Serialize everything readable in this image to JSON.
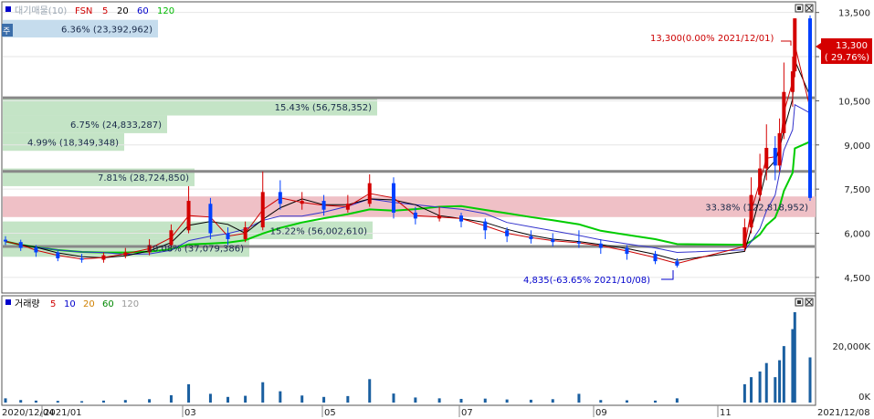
{
  "price_panel": {
    "legend": [
      {
        "text": "대기매물(10)",
        "color": "#9aa6b2"
      },
      {
        "text": "FSN",
        "color": "#d00000"
      },
      {
        "text": "5",
        "color": "#d00000"
      },
      {
        "text": "20",
        "color": "#000000"
      },
      {
        "text": "60",
        "color": "#0000cc"
      },
      {
        "text": "120",
        "color": "#00bb00"
      }
    ],
    "side_tab": "주",
    "y_ticks": [
      "13,500",
      "12,000",
      "10,500",
      "9,000",
      "7,500",
      "6,000",
      "4,500"
    ],
    "current_price": "13,300",
    "current_change": "( 29.76%)",
    "max_annotation": "13,300(0.00% 2021/12/01)",
    "min_annotation": "4,835(-63.65% 2021/10/08)"
  },
  "volume_panel": {
    "legend": [
      {
        "text": "거래량",
        "color": "#000000"
      },
      {
        "text": "5",
        "color": "#d00000"
      },
      {
        "text": "10",
        "color": "#0000cc"
      },
      {
        "text": "20",
        "color": "#d08000"
      },
      {
        "text": "60",
        "color": "#008800"
      },
      {
        "text": "120",
        "color": "#999999"
      }
    ],
    "y_ticks": [
      "20,000K",
      "0K"
    ]
  },
  "x_axis": [
    "2020/12/04",
    "2021/01",
    "03",
    "05",
    "07",
    "09",
    "11",
    "2021/12/08"
  ],
  "chart_data": {
    "type": "candlestick",
    "y_axis": {
      "min": 4000,
      "max": 13800,
      "ticks": [
        13500,
        12000,
        10500,
        9000,
        7500,
        6000,
        4500
      ]
    },
    "volume_axis": {
      "min": 0,
      "max": 32000,
      "unit": "K",
      "ticks": [
        20000,
        0
      ]
    },
    "resistance_lines": [
      10600,
      8100,
      5550
    ],
    "volume_profile": [
      {
        "label": "6.36% (23,392,962)",
        "y_low": 12650,
        "y_high": 13250,
        "highlight": false
      },
      {
        "label": "15.43% (56,758,352)",
        "y_low": 10000,
        "y_high": 10600,
        "highlight": false
      },
      {
        "label": "6.75% (24,833,287)",
        "y_low": 9400,
        "y_high": 10000,
        "highlight": false
      },
      {
        "label": "4.99% (18,349,348)",
        "y_low": 8800,
        "y_high": 9400,
        "highlight": false
      },
      {
        "label": "7.81% (28,724,850)",
        "y_low": 7600,
        "y_high": 8200,
        "highlight": false
      },
      {
        "label": "33.38% (122,818,952)",
        "y_low": 6550,
        "y_high": 7250,
        "highlight": true
      },
      {
        "label": "15.22% (56,002,610)",
        "y_low": 5800,
        "y_high": 6400,
        "highlight": false
      },
      {
        "label": "10.08% (37,079,386)",
        "y_low": 5200,
        "y_high": 5800,
        "highlight": false
      }
    ],
    "candles": [
      {
        "x": "2020/12/04",
        "o": 5780,
        "c": 5720,
        "h": 5900,
        "l": 5600
      },
      {
        "x": "2020/12/11",
        "o": 5700,
        "c": 5500,
        "h": 5780,
        "l": 5400
      },
      {
        "x": "2020/12/18",
        "o": 5520,
        "c": 5350,
        "h": 5600,
        "l": 5200
      },
      {
        "x": "2020/12/28",
        "o": 5350,
        "c": 5150,
        "h": 5400,
        "l": 5050
      },
      {
        "x": "2021/01/08",
        "o": 5150,
        "c": 5100,
        "h": 5300,
        "l": 5000
      },
      {
        "x": "2021/01/18",
        "o": 5100,
        "c": 5250,
        "h": 5350,
        "l": 5000
      },
      {
        "x": "2021/01/28",
        "o": 5250,
        "c": 5350,
        "h": 5500,
        "l": 5150
      },
      {
        "x": "2021/02/08",
        "o": 5350,
        "c": 5600,
        "h": 5800,
        "l": 5250
      },
      {
        "x": "2021/02/18",
        "o": 5600,
        "c": 6100,
        "h": 6300,
        "l": 5500
      },
      {
        "x": "2021/02/26",
        "o": 6100,
        "c": 7100,
        "h": 7600,
        "l": 6000
      },
      {
        "x": "2021/03/08",
        "o": 7000,
        "c": 6000,
        "h": 7200,
        "l": 5800
      },
      {
        "x": "2021/03/16",
        "o": 6000,
        "c": 5800,
        "h": 6200,
        "l": 5600
      },
      {
        "x": "2021/03/24",
        "o": 5800,
        "c": 6200,
        "h": 6400,
        "l": 5700
      },
      {
        "x": "2021/04/01",
        "o": 6200,
        "c": 7400,
        "h": 8100,
        "l": 6100
      },
      {
        "x": "2021/04/09",
        "o": 7400,
        "c": 7000,
        "h": 7800,
        "l": 6800
      },
      {
        "x": "2021/04/19",
        "o": 7000,
        "c": 7100,
        "h": 7400,
        "l": 6800
      },
      {
        "x": "2021/04/29",
        "o": 7100,
        "c": 6800,
        "h": 7300,
        "l": 6600
      },
      {
        "x": "2021/05/10",
        "o": 6800,
        "c": 7000,
        "h": 7300,
        "l": 6700
      },
      {
        "x": "2021/05/20",
        "o": 7000,
        "c": 7700,
        "h": 8000,
        "l": 6900
      },
      {
        "x": "2021/05/31",
        "o": 7700,
        "c": 6700,
        "h": 7900,
        "l": 6500
      },
      {
        "x": "2021/06/10",
        "o": 6700,
        "c": 6500,
        "h": 6900,
        "l": 6300
      },
      {
        "x": "2021/06/21",
        "o": 6500,
        "c": 6600,
        "h": 6900,
        "l": 6400
      },
      {
        "x": "2021/07/01",
        "o": 6600,
        "c": 6400,
        "h": 6700,
        "l": 6200
      },
      {
        "x": "2021/07/12",
        "o": 6400,
        "c": 6100,
        "h": 6500,
        "l": 5800
      },
      {
        "x": "2021/07/22",
        "o": 6100,
        "c": 5900,
        "h": 6200,
        "l": 5700
      },
      {
        "x": "2021/08/02",
        "o": 5900,
        "c": 5800,
        "h": 6100,
        "l": 5650
      },
      {
        "x": "2021/08/12",
        "o": 5800,
        "c": 5700,
        "h": 6000,
        "l": 5550
      },
      {
        "x": "2021/08/24",
        "o": 5700,
        "c": 5650,
        "h": 6100,
        "l": 5500
      },
      {
        "x": "2021/09/03",
        "o": 5650,
        "c": 5500,
        "h": 5800,
        "l": 5300
      },
      {
        "x": "2021/09/15",
        "o": 5500,
        "c": 5300,
        "h": 5600,
        "l": 5100
      },
      {
        "x": "2021/09/28",
        "o": 5300,
        "c": 5050,
        "h": 5400,
        "l": 4950
      },
      {
        "x": "2021/10/08",
        "o": 5050,
        "c": 4900,
        "h": 5150,
        "l": 4835
      },
      {
        "x": "2021/11/08",
        "o": 5500,
        "c": 6200,
        "h": 6500,
        "l": 5400
      },
      {
        "x": "2021/11/11",
        "o": 6200,
        "c": 7300,
        "h": 7900,
        "l": 6000
      },
      {
        "x": "2021/11/15",
        "o": 7300,
        "c": 8200,
        "h": 8700,
        "l": 7100
      },
      {
        "x": "2021/11/18",
        "o": 8200,
        "c": 8900,
        "h": 9700,
        "l": 7800
      },
      {
        "x": "2021/11/22",
        "o": 8900,
        "c": 8300,
        "h": 9300,
        "l": 7800
      },
      {
        "x": "2021/11/24",
        "o": 8300,
        "c": 9400,
        "h": 9900,
        "l": 8100
      },
      {
        "x": "2021/11/26",
        "o": 9400,
        "c": 10800,
        "h": 11800,
        "l": 9200
      },
      {
        "x": "2021/11/30",
        "o": 10800,
        "c": 11500,
        "h": 12000,
        "l": 10300
      },
      {
        "x": "2021/12/01",
        "o": 11500,
        "c": 13300,
        "h": 13300,
        "l": 11300
      },
      {
        "x": "2021/12/08",
        "o": 13300,
        "c": 7200,
        "h": 13400,
        "l": 7100
      }
    ],
    "volume_heights": [
      1500,
      900,
      700,
      600,
      500,
      700,
      900,
      1200,
      2600,
      6500,
      3100,
      2000,
      2400,
      7200,
      4000,
      2500,
      2000,
      2300,
      8300,
      3200,
      1800,
      1500,
      1300,
      1400,
      1100,
      1000,
      1200,
      3100,
      900,
      800,
      700,
      1500,
      6500,
      9000,
      11000,
      14000,
      9000,
      15000,
      20000,
      26000,
      32000,
      16000
    ]
  }
}
